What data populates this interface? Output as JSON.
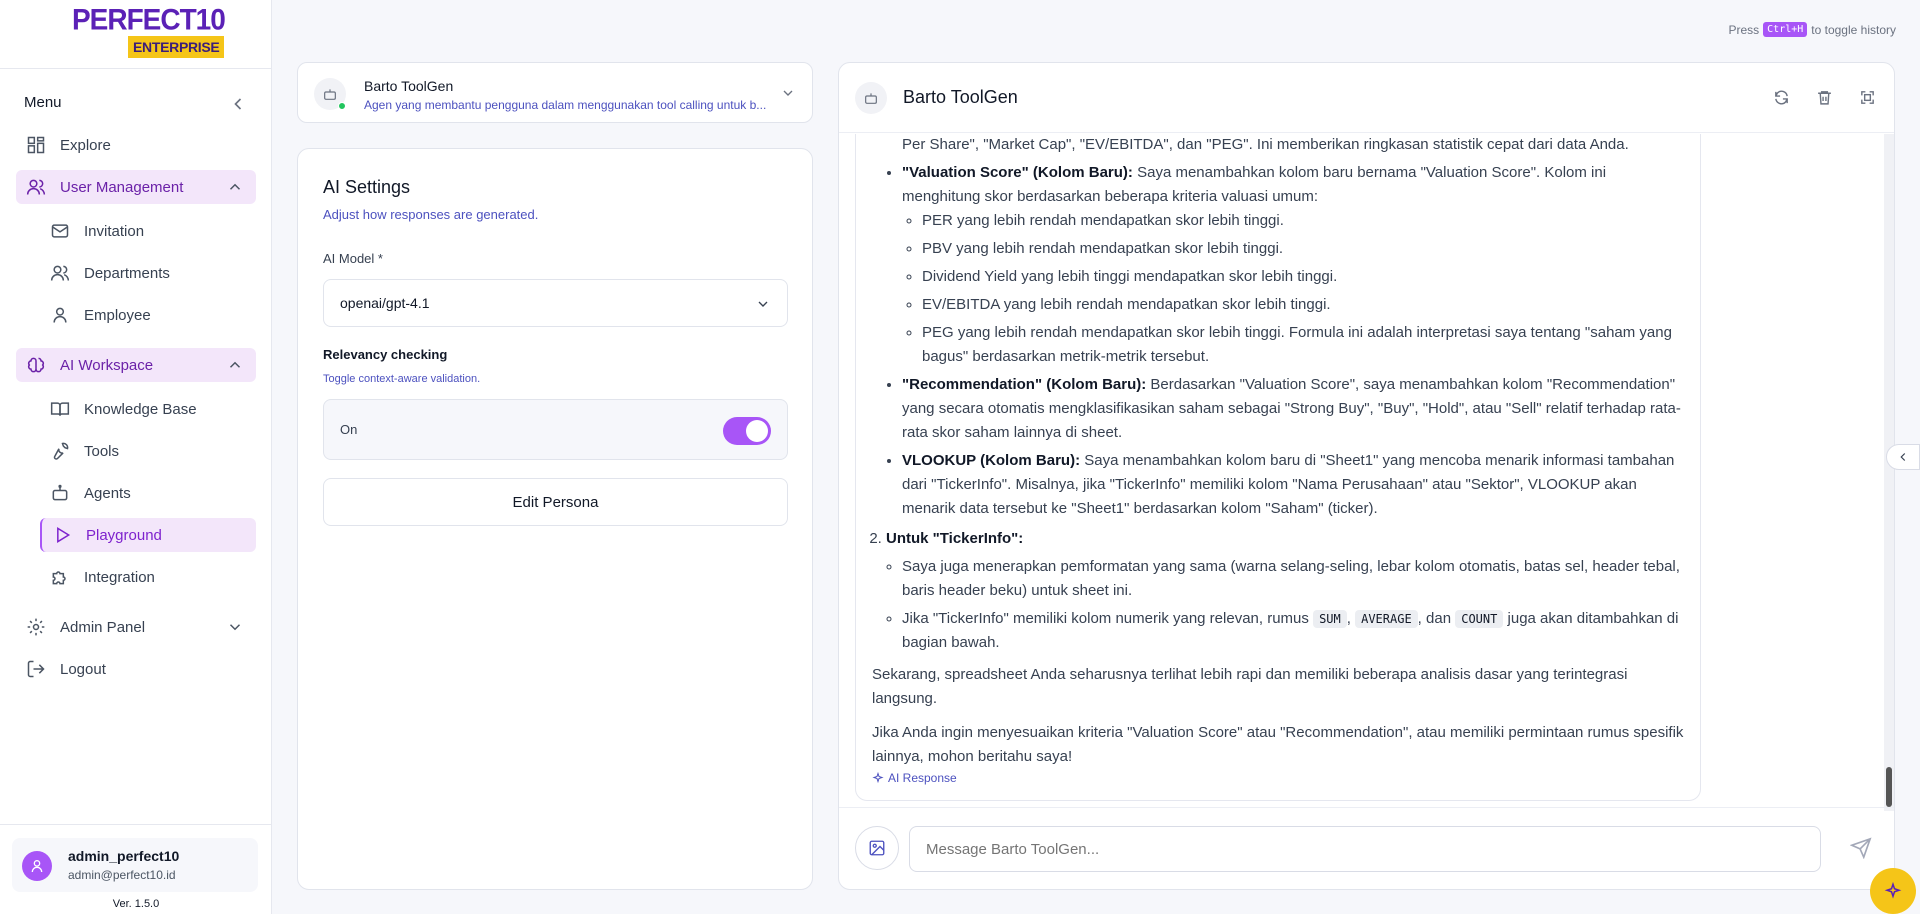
{
  "brand": {
    "name": "PERFECT10",
    "edition": "ENTERPRISE"
  },
  "hint": {
    "prefix": "Press",
    "key": "Ctrl+H",
    "suffix": "to toggle history"
  },
  "sidebar": {
    "menu_label": "Menu",
    "items": [
      {
        "label": "Explore",
        "icon": "grid-icon"
      },
      {
        "label": "User Management",
        "icon": "users-icon"
      },
      {
        "label": "Invitation",
        "icon": "mail-icon"
      },
      {
        "label": "Departments",
        "icon": "users-icon"
      },
      {
        "label": "Employee",
        "icon": "user-icon"
      },
      {
        "label": "AI Workspace",
        "icon": "brain-icon"
      },
      {
        "label": "Knowledge Base",
        "icon": "book-icon"
      },
      {
        "label": "Tools",
        "icon": "wrench-icon"
      },
      {
        "label": "Agents",
        "icon": "bot-icon"
      },
      {
        "label": "Playground",
        "icon": "play-icon"
      },
      {
        "label": "Integration",
        "icon": "puzzle-icon"
      },
      {
        "label": "Admin Panel",
        "icon": "gear-icon"
      },
      {
        "label": "Logout",
        "icon": "logout-icon"
      }
    ],
    "user": {
      "name": "admin_perfect10",
      "email": "admin@perfect10.id"
    },
    "version": "Ver. 1.5.0"
  },
  "agent_selector": {
    "name": "Barto ToolGen",
    "description": "Agen yang membantu pengguna dalam menggunakan tool calling untuk b..."
  },
  "settings": {
    "title": "AI Settings",
    "subtitle": "Adjust how responses are generated.",
    "model_label": "AI Model *",
    "model_value": "openai/gpt-4.1",
    "relevancy_label": "Relevancy checking",
    "relevancy_sub": "Toggle context-aware validation.",
    "toggle_state": "On",
    "toggle_on": true,
    "persona_button": "Edit Persona"
  },
  "chat": {
    "title": "Barto ToolGen",
    "partial_top": "Per Share\", \"Market Cap\", \"EV/EBITDA\", dan \"PEG\". Ini memberikan ringkasan statistik cepat dari data Anda.",
    "vs_title": "\"Valuation Score\" (Kolom Baru):",
    "vs_text": "Saya menambahkan kolom baru bernama \"Valuation Score\". Kolom ini menghitung skor berdasarkan beberapa kriteria valuasi umum:",
    "criteria": [
      "PER yang lebih rendah mendapatkan skor lebih tinggi.",
      "PBV yang lebih rendah mendapatkan skor lebih tinggi.",
      "Dividend Yield yang lebih tinggi mendapatkan skor lebih tinggi.",
      "EV/EBITDA yang lebih rendah mendapatkan skor lebih tinggi.",
      "PEG yang lebih rendah mendapatkan skor lebih tinggi. Formula ini adalah interpretasi saya tentang \"saham yang bagus\" berdasarkan metrik-metrik tersebut."
    ],
    "rec_title": "\"Recommendation\" (Kolom Baru):",
    "rec_text": "Berdasarkan \"Valuation Score\", saya menambahkan kolom \"Recommendation\" yang secara otomatis mengklasifikasikan saham sebagai \"Strong Buy\", \"Buy\", \"Hold\", atau \"Sell\" relatif terhadap rata-rata skor saham lainnya di sheet.",
    "vl_title": "VLOOKUP (Kolom Baru):",
    "vl_text": "Saya menambahkan kolom baru di \"Sheet1\" yang mencoba menarik informasi tambahan dari \"TickerInfo\". Misalnya, jika \"TickerInfo\" memiliki kolom \"Nama Perusahaan\" atau \"Sektor\", VLOOKUP akan menarik data tersebut ke \"Sheet1\" berdasarkan kolom \"Saham\" (ticker).",
    "ti_title": "Untuk \"TickerInfo\":",
    "ti_item1": "Saya juga menerapkan pemformatan yang sama (warna selang-seling, lebar kolom otomatis, batas sel, header tebal, baris header beku) untuk sheet ini.",
    "ti_item2_pre": "Jika \"TickerInfo\" memiliki kolom numerik yang relevan, rumus",
    "code_sum": "SUM",
    "code_avg": "AVERAGE",
    "sep_comma": ",",
    "sep_dan": ", dan",
    "code_count": "COUNT",
    "ti_item2_post": "juga akan ditambahkan di bagian bawah.",
    "para1": "Sekarang, spreadsheet Anda seharusnya terlihat lebih rapi dan memiliki beberapa analisis dasar yang terintegrasi langsung.",
    "para2": "Jika Anda ingin menyesuaikan kriteria \"Valuation Score\" atau \"Recommendation\", atau memiliki permintaan rumus spesifik lainnya, mohon beritahu saya!",
    "ai_response_label": "AI Response",
    "input_placeholder": "Message Barto ToolGen..."
  },
  "colors": {
    "accent": "#a855f7",
    "brand": "#5b21b6",
    "gold": "#f5c518"
  }
}
